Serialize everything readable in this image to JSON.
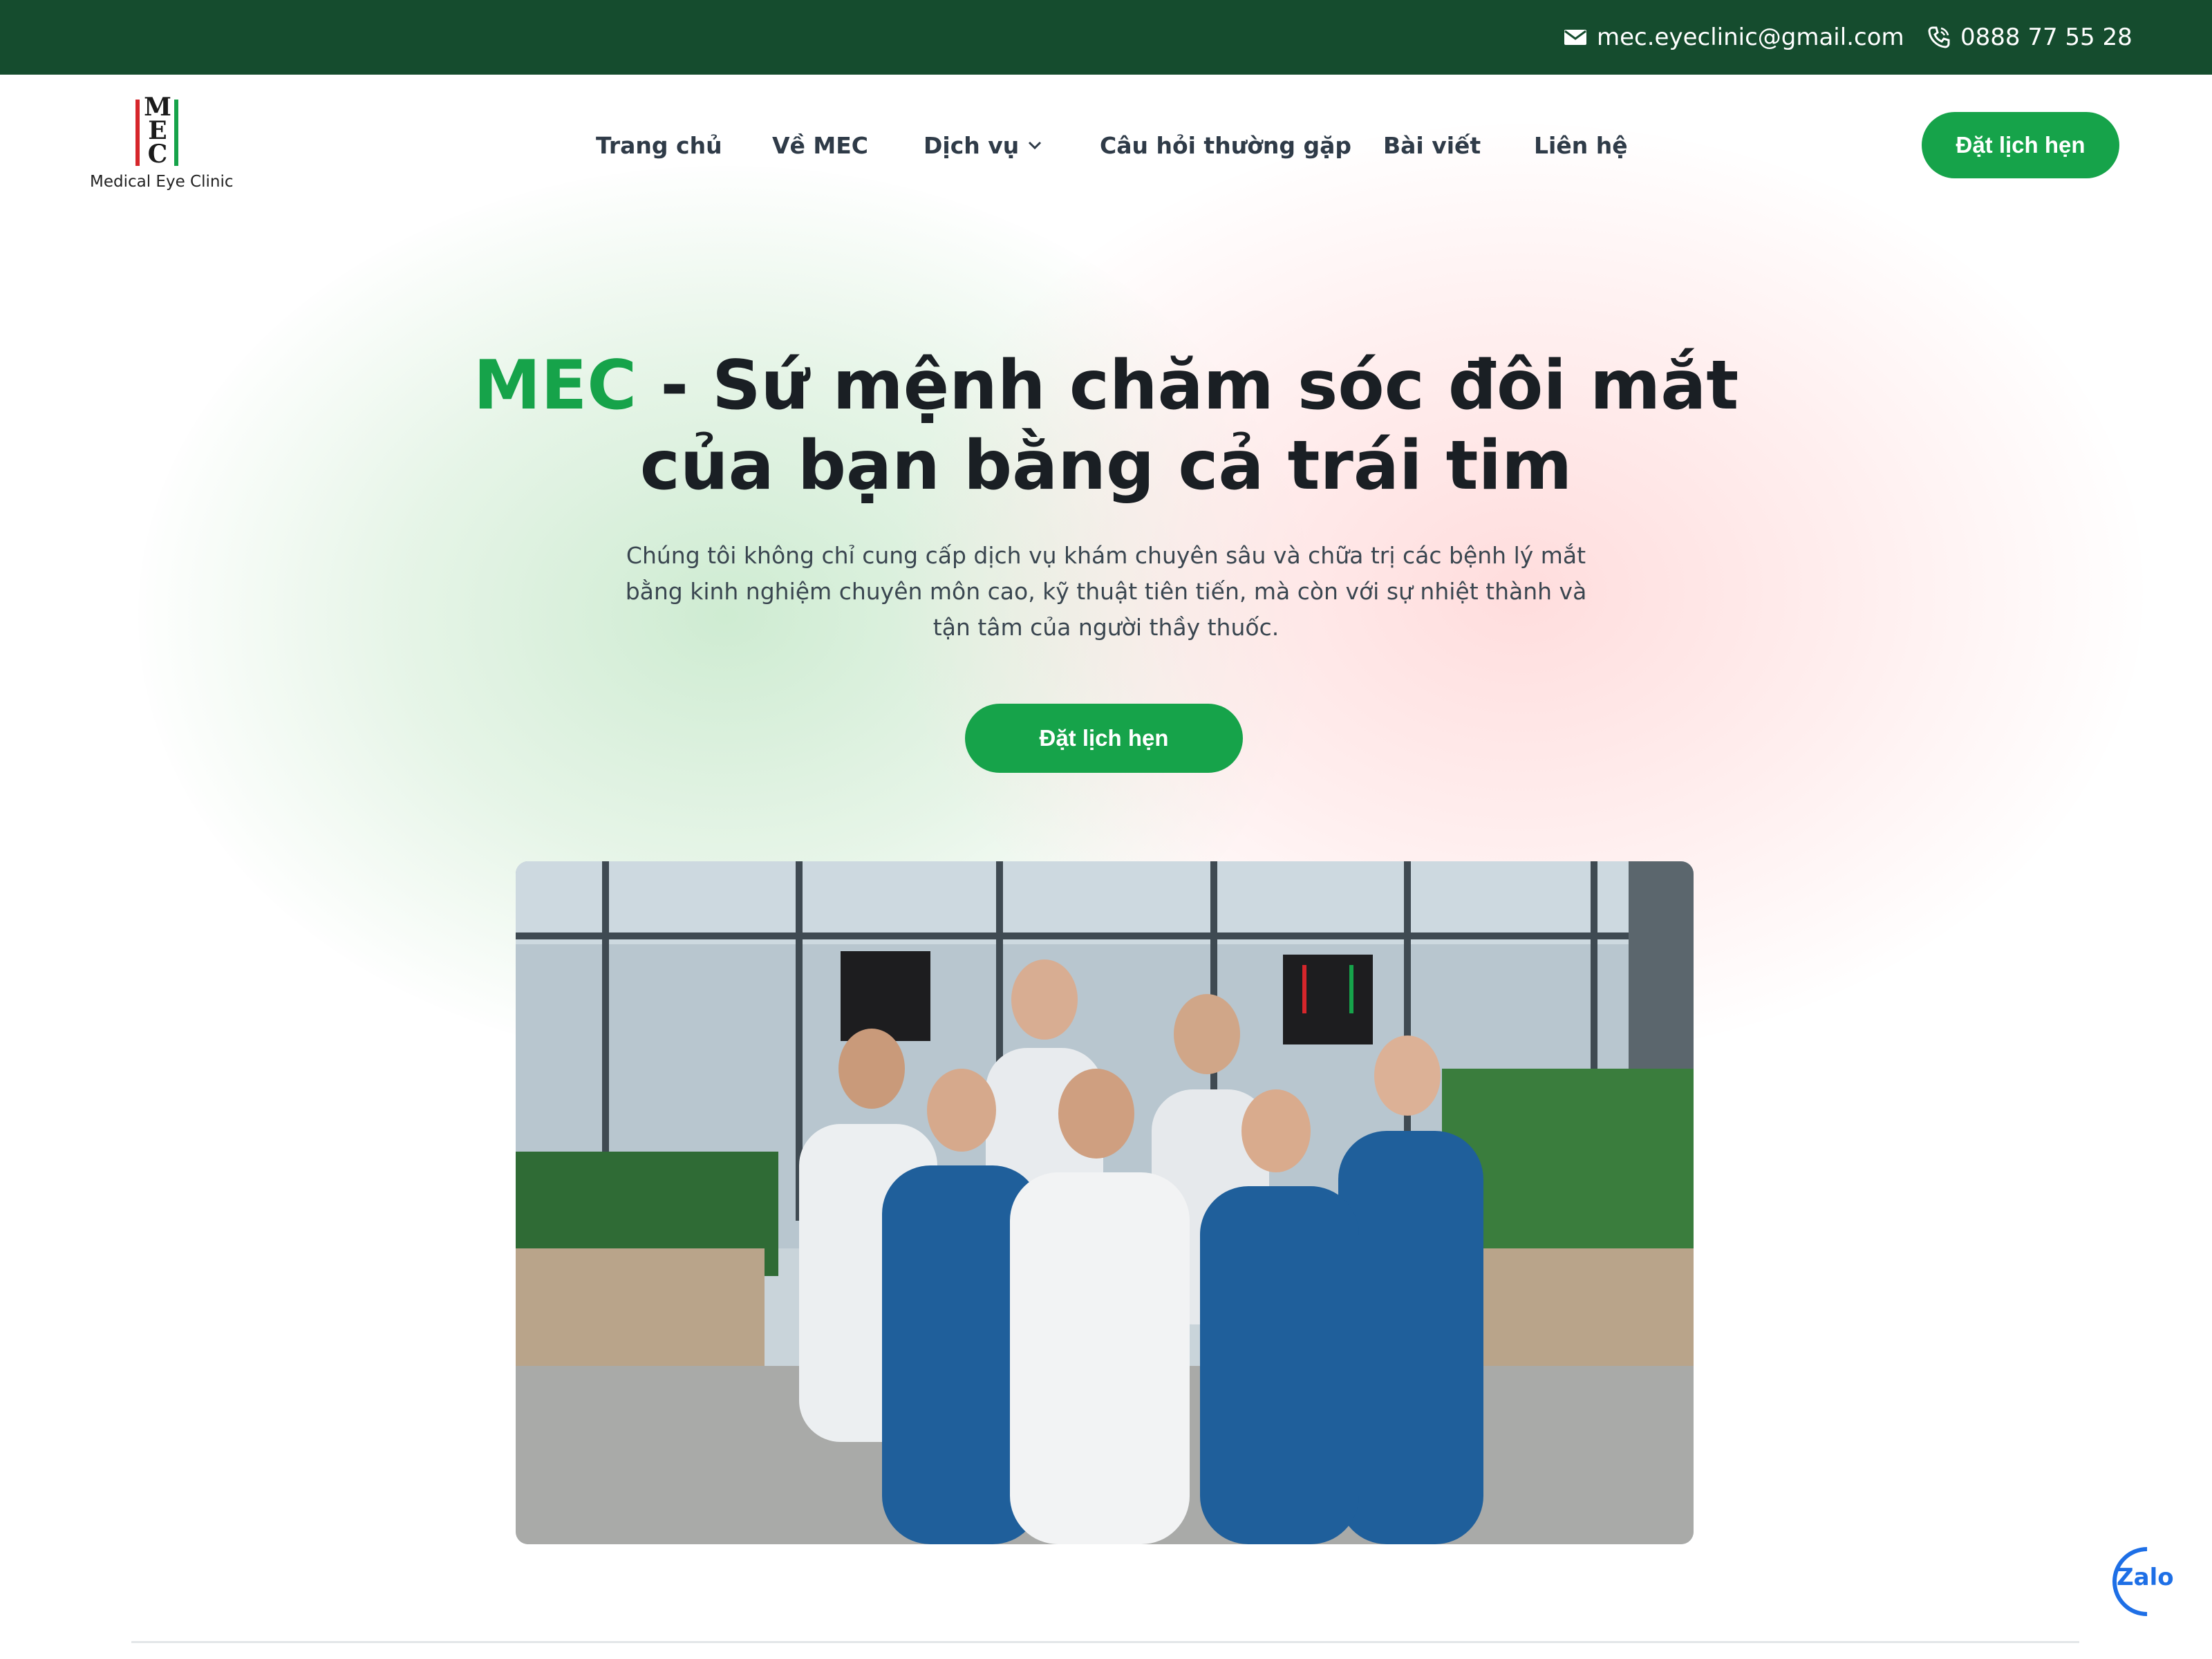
{
  "topbar": {
    "email": "mec.eyeclinic@gmail.com",
    "phone": "0888 77 55 28",
    "email_icon": "mail-icon",
    "phone_icon": "phone-icon",
    "bg_color": "#154c2e"
  },
  "logo": {
    "letters": "MEC",
    "tagline": "Medical Eye Clinic"
  },
  "nav": {
    "items": [
      {
        "label": "Trang chủ"
      },
      {
        "label": "Về MEC"
      },
      {
        "label": "Dịch vụ",
        "has_dropdown": true
      },
      {
        "label": "Câu hỏi thường gặp"
      },
      {
        "label": "Bài viết"
      },
      {
        "label": "Liên hệ"
      }
    ],
    "cta_label": "Đặt lịch hẹn"
  },
  "hero": {
    "title_accent": "MEC",
    "title_rest_line1": " - Sứ mệnh chăm sóc đôi mắt",
    "title_line2": "của bạn bằng cả trái tim",
    "description": "Chúng tôi không chỉ cung cấp dịch vụ khám chuyên sâu và chữa trị các bệnh lý mắt bằng kinh nghiệm chuyên môn cao, kỹ thuật tiên tiến, mà còn với sự nhiệt thành và tận tâm của người thầy thuốc.",
    "cta_label": "Đặt lịch hẹn"
  },
  "colors": {
    "accent": "#16a34a",
    "dark_green": "#154c2e",
    "heading": "#1a1f24"
  },
  "zalo": {
    "label": "Zalo"
  }
}
